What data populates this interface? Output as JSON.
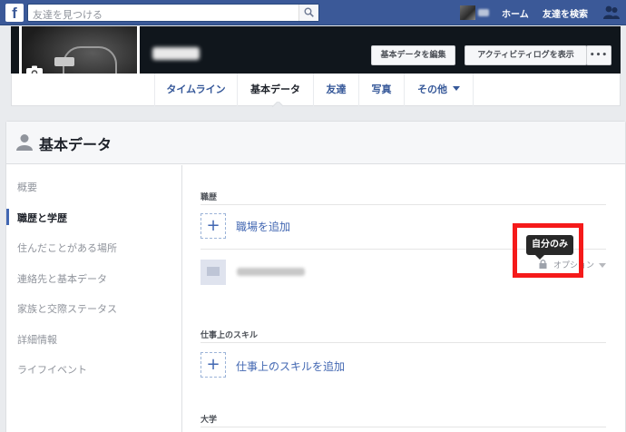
{
  "topbar": {
    "logo": "f",
    "search_placeholder": "友達を見つける",
    "home_label": "ホーム",
    "find_friends_label": "友達を検索",
    "icons": [
      "facebook-logo-icon",
      "search-icon",
      "friend-requests-icon"
    ]
  },
  "cover": {
    "edit_basic_button": "基本データを編集",
    "activity_log_button": "アクティビティログを表示",
    "more_button": "•••"
  },
  "tabs": [
    {
      "label": "タイムライン",
      "active": false
    },
    {
      "label": "基本データ",
      "active": true
    },
    {
      "label": "友達",
      "active": false
    },
    {
      "label": "写真",
      "active": false
    },
    {
      "label": "その他",
      "active": false
    }
  ],
  "panel": {
    "title": "基本データ",
    "sidebar": [
      {
        "label": "概要",
        "active": false
      },
      {
        "label": "職歴と学歴",
        "active": true
      },
      {
        "label": "住んだことがある場所",
        "active": false
      },
      {
        "label": "連絡先と基本データ",
        "active": false
      },
      {
        "label": "家族と交際ステータス",
        "active": false
      },
      {
        "label": "詳細情報",
        "active": false
      },
      {
        "label": "ライフイベント",
        "active": false
      }
    ],
    "sections": {
      "work": {
        "title": "職歴",
        "add_label": "職場を追加",
        "add_icon": "+",
        "option_label": "オプション"
      },
      "skills": {
        "title": "仕事上のスキル",
        "add_label": "仕事上のスキルを追加",
        "add_icon": "+"
      },
      "college": {
        "title": "大学"
      }
    },
    "tooltip": "自分のみ"
  },
  "colors": {
    "brand": "#3b5998",
    "link": "#4267b2",
    "highlight": "#f51a1a"
  }
}
